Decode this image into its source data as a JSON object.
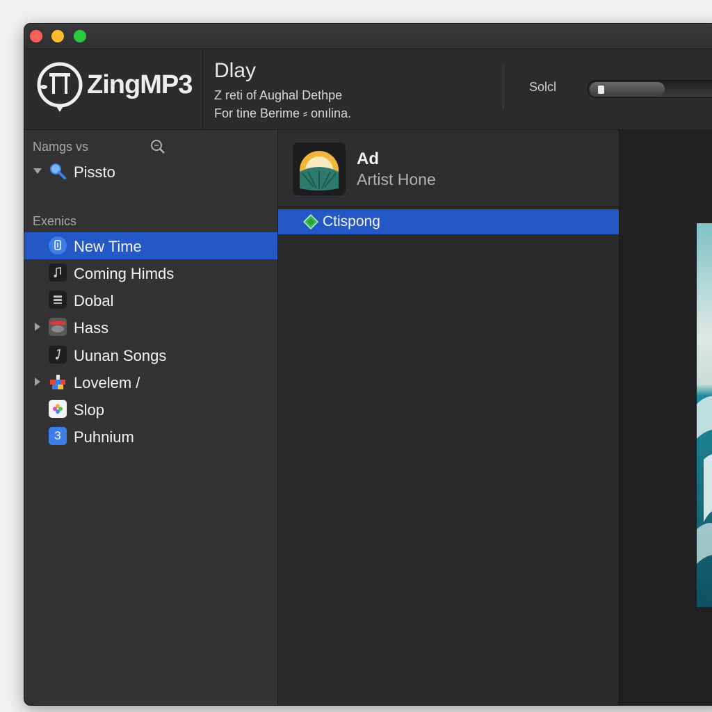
{
  "window": {
    "traffic_lights": [
      "close",
      "minimize",
      "zoom"
    ]
  },
  "header": {
    "app_name": "ZingMP3",
    "now_playing": {
      "title": "Dlay",
      "line1": "Z reti of Aughal Dethpe",
      "line2": "For tine Berime ⸗ onılina."
    },
    "solo_label": "Solcl",
    "volume": 0.55
  },
  "sidebar": {
    "heading": "Namgs vs",
    "search_icon": "search-icon",
    "top_item": {
      "label": "Pissto",
      "icon": "magnifier-icon",
      "expanded": true
    },
    "section_label": "Exenics",
    "items": [
      {
        "label": "New Time",
        "icon": "library-icon",
        "selected": true,
        "disclosure": false
      },
      {
        "label": "Coming Himds",
        "icon": "music-note-icon",
        "selected": false,
        "disclosure": false
      },
      {
        "label": "Dobal",
        "icon": "grid-icon",
        "selected": false,
        "disclosure": false
      },
      {
        "label": "Hass",
        "icon": "red-drive-icon",
        "selected": false,
        "disclosure": true
      },
      {
        "label": "Uunan Songs",
        "icon": "music-note-icon",
        "selected": false,
        "disclosure": false
      },
      {
        "label": "Lovelem /",
        "icon": "colorful-blocks-icon",
        "selected": false,
        "disclosure": true
      },
      {
        "label": "Slop",
        "icon": "photos-icon",
        "selected": false,
        "disclosure": false
      },
      {
        "label": "Puhnium",
        "icon": "number-badge-icon",
        "badge": "3",
        "selected": false,
        "disclosure": false
      }
    ]
  },
  "artist": {
    "name": "Ad",
    "subtitle": "Artist Hone",
    "art_icon": "sunrise-art-icon"
  },
  "list": {
    "selected_item": "Ctispong",
    "item_icon": "green-diamond-icon"
  },
  "preview": {
    "image": "ocean-wave-image"
  },
  "colors": {
    "selection": "#2458c6",
    "background": "#2b2b2e",
    "accent_green": "#3dbb4a"
  }
}
